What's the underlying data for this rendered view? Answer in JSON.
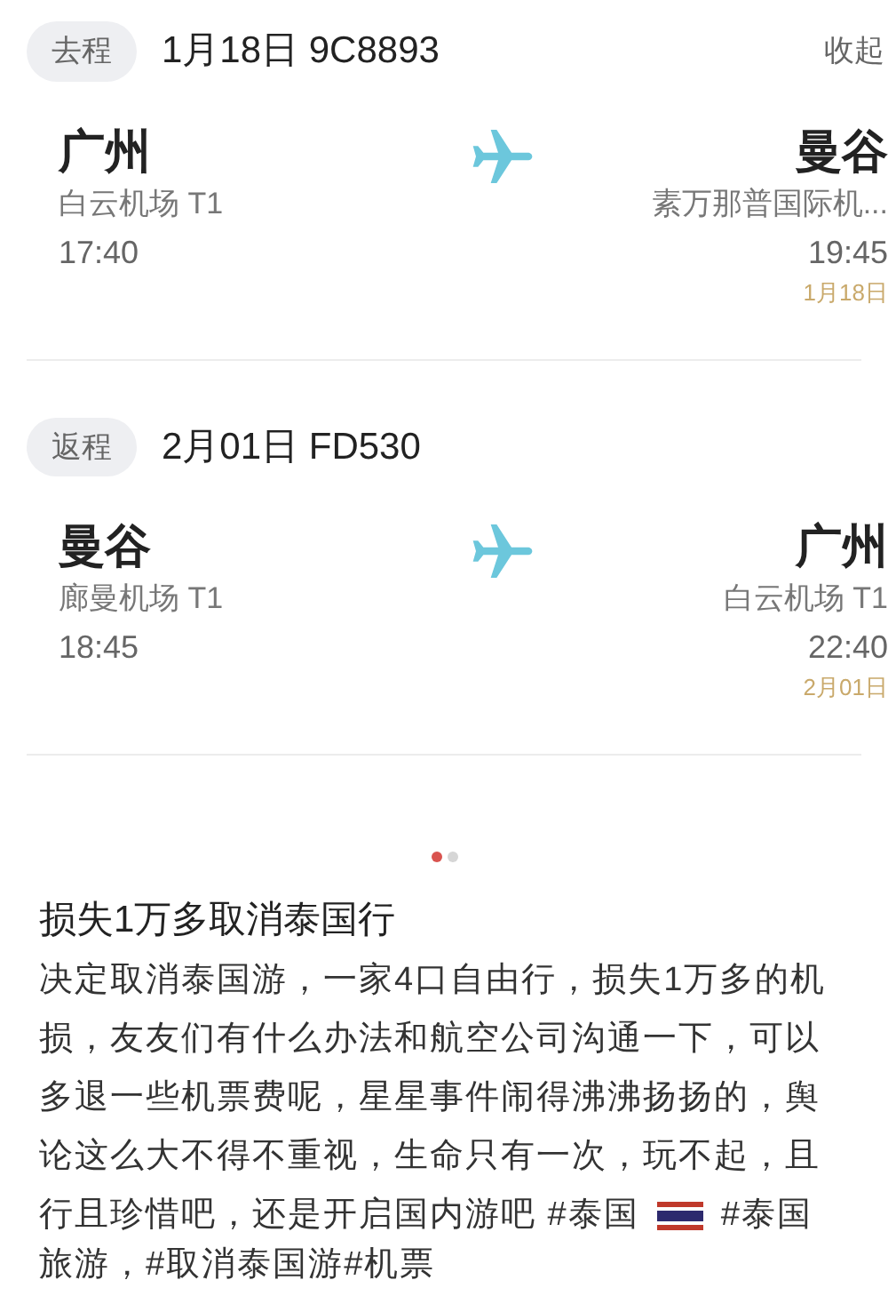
{
  "flights": [
    {
      "leg": "去程",
      "info": "1月18日 9C8893",
      "action": "收起",
      "from": {
        "city": "广州",
        "airport": "白云机场 T1",
        "time": "17:40"
      },
      "to": {
        "city": "曼谷",
        "airport": "素万那普国际机...",
        "time": "19:45",
        "date": "1月18日"
      }
    },
    {
      "leg": "返程",
      "info": "2月01日 FD530",
      "from": {
        "city": "曼谷",
        "airport": "廊曼机场 T1",
        "time": "18:45"
      },
      "to": {
        "city": "广州",
        "airport": "白云机场 T1",
        "time": "22:40",
        "date": "2月01日"
      }
    }
  ],
  "pager": [
    {
      "selected": true
    },
    {
      "selected": false
    }
  ],
  "post": {
    "title": "损失1万多取消泰国行",
    "body_lines": [
      "决定取消泰国游，一家4口自由行，损失1万多的机",
      "损，友友们有什么办法和航空公司沟通一下，可以",
      "多退一些机票费呢，星星事件闹得沸沸扬扬的，舆",
      "论这么大不得不重视，生命只有一次，玩不起，且"
    ],
    "flag_line": {
      "before": "行且珍惜吧，还是开启国内游吧 #泰国",
      "after": "#泰国"
    },
    "last_line": "旅游，#取消泰国游#机票"
  }
}
